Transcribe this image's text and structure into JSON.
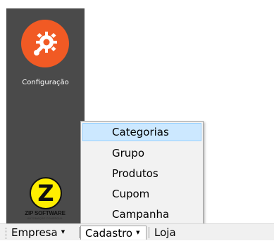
{
  "sidebar": {
    "config_label": "Configuração",
    "config_icon": "gear-wrench-icon",
    "logo_letter": "Z",
    "logo_text": "ZIP SOFTWARE",
    "logo_subtext": "AUTOMAÇÃO COMERCIAL"
  },
  "menu": {
    "items": [
      {
        "label": "Categorias",
        "highlighted": true
      },
      {
        "label": "Grupo"
      },
      {
        "label": "Produtos"
      },
      {
        "label": "Cupom"
      },
      {
        "label": "Campanha"
      }
    ]
  },
  "menubar": {
    "items": [
      {
        "label": "Empresa",
        "has_dropdown": true
      },
      {
        "label": "Cadastro",
        "has_dropdown": true,
        "open": true
      },
      {
        "label": "Loja",
        "has_dropdown": false
      }
    ],
    "caret_glyph": "▼"
  },
  "colors": {
    "sidebar_bg": "#4a4a4a",
    "config_accent": "#f15a24",
    "logo_yellow": "#ffee00",
    "menu_highlight": "#cce8ff"
  }
}
